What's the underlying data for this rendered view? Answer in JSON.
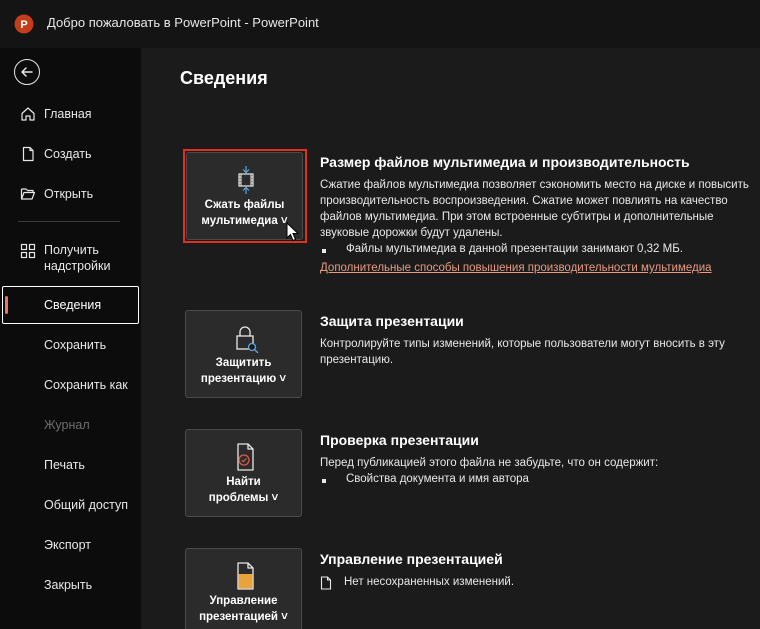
{
  "window": {
    "title": "Добро пожаловать в PowerPoint  -  PowerPoint",
    "app_icon_letter": "P"
  },
  "sidebar": {
    "items": [
      {
        "label": "Главная",
        "icon": "home-icon"
      },
      {
        "label": "Создать",
        "icon": "new-document-icon"
      },
      {
        "label": "Открыть",
        "icon": "folder-open-icon"
      },
      {
        "label": "Получить\nнадстройки",
        "icon": "addins-grid-icon"
      },
      {
        "label": "Сведения"
      },
      {
        "label": "Сохранить"
      },
      {
        "label": "Сохранить как"
      },
      {
        "label": "Журнал",
        "disabled": true
      },
      {
        "label": "Печать"
      },
      {
        "label": "Общий доступ"
      },
      {
        "label": "Экспорт"
      },
      {
        "label": "Закрыть"
      }
    ],
    "active": "Сведения"
  },
  "main": {
    "title": "Сведения",
    "sections": [
      {
        "button_label": "Сжать файлы\nмультимедиа ˅",
        "heading": "Размер файлов мультимедиа и производительность",
        "text": "Сжатие файлов мультимедиа позволяет сэкономить место на диске и повысить производительность воспроизведения. Сжатие может повлиять на качество файлов мультимедиа. При этом встроенные субтитры и дополнительные звуковые дорожки будут удалены.",
        "bullet": "Файлы мультимедиа в данной презентации занимают 0,32 МБ.",
        "link": "Дополнительные способы повышения производительности мультимедиа"
      },
      {
        "button_label": "Защитить\nпрезентацию ˅",
        "heading": "Защита презентации",
        "text": "Контролируйте типы изменений, которые пользователи могут вносить в эту презентацию."
      },
      {
        "button_label": "Найти\nпроблемы ˅",
        "heading": "Проверка презентации",
        "text": "Перед публикацией этого файла не забудьте, что он содержит:",
        "bullet": "Свойства документа и имя автора"
      },
      {
        "button_label": "Управление\nпрезентацией ˅",
        "heading": "Управление презентацией",
        "status": "Нет несохраненных изменений."
      }
    ]
  },
  "colors": {
    "accent": "#e8765a",
    "highlight_border": "#e0311e",
    "link": "#e89a82",
    "app_icon": "#c43e1c"
  }
}
